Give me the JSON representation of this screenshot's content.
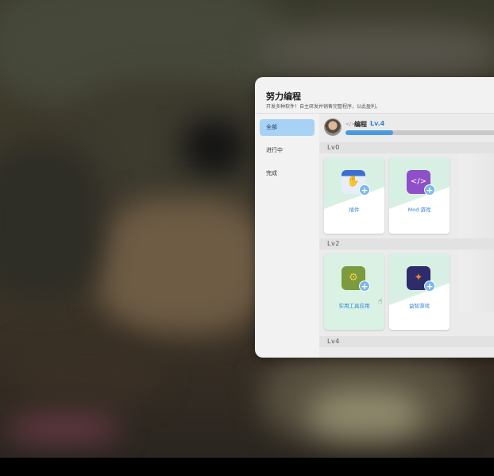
{
  "panel": {
    "title": "努力编程",
    "subtitle": "开发多种软件！自主研发并销售完整程序，以此盈利。"
  },
  "sidebar": {
    "items": [
      {
        "label": "全部",
        "active": true
      },
      {
        "label": "进行中",
        "active": false
      },
      {
        "label": "完成",
        "active": false
      }
    ]
  },
  "skill": {
    "icon_text": "</>",
    "name": "编程",
    "level": "Lv.4",
    "progress": 0.29
  },
  "sections": [
    {
      "label": "Lv0",
      "cards": [
        {
          "label": "插件",
          "icon": "plugin-icon"
        },
        {
          "label": "Mod 游戏",
          "icon": "mod-game-icon"
        }
      ]
    },
    {
      "label": "Lv2",
      "cards": [
        {
          "label": "实用工具应用",
          "icon": "utility-app-icon"
        },
        {
          "label": "益智游戏",
          "icon": "puzzle-game-icon"
        }
      ]
    },
    {
      "label": "Lv4",
      "cards": []
    }
  ],
  "colors": {
    "accent": "#2f84d4",
    "active_tab": "#a8d2f5",
    "progress_fill": "#4a9ae0",
    "card_tint": "#d9f2e3"
  }
}
